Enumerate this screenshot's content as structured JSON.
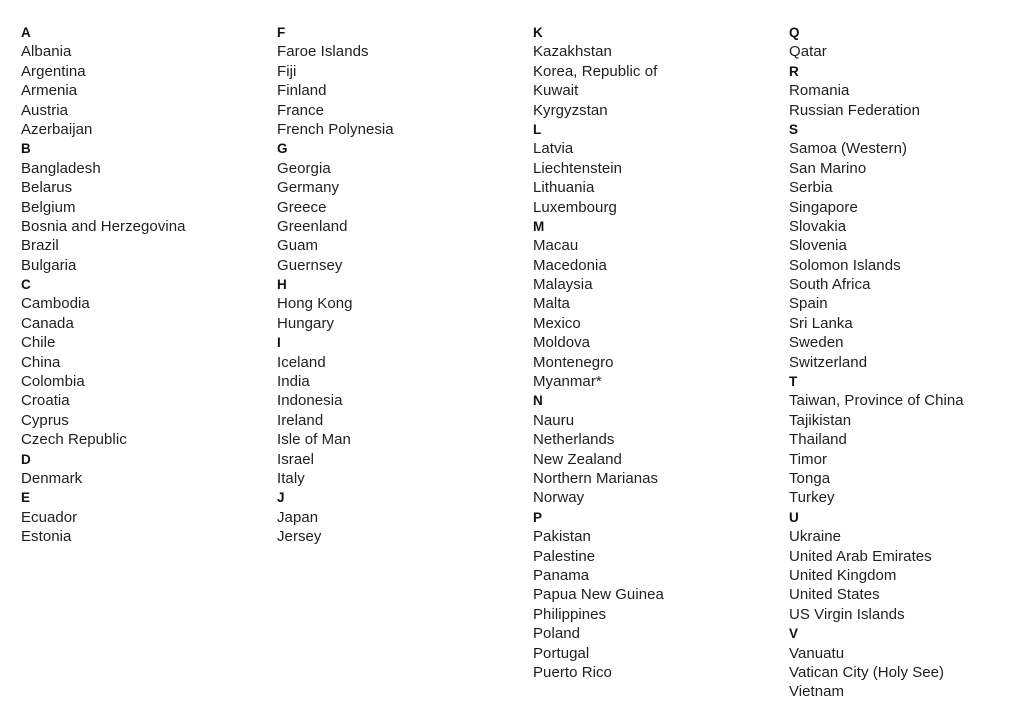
{
  "document": {
    "type": "country-index-list",
    "text_color": "#1f1f1f",
    "heading_color": "#111111",
    "background_color": "#ffffff",
    "columns": [
      {
        "groups": [
          {
            "letter": "A",
            "countries": [
              "Albania",
              "Argentina",
              "Armenia",
              "Austria",
              "Azerbaijan"
            ]
          },
          {
            "letter": "B",
            "countries": [
              "Bangladesh",
              "Belarus",
              "Belgium",
              "Bosnia and Herzegovina",
              "Brazil",
              "Bulgaria"
            ]
          },
          {
            "letter": "C",
            "countries": [
              "Cambodia",
              "Canada",
              "Chile",
              "China",
              "Colombia",
              "Croatia",
              "Cyprus",
              "Czech Republic"
            ]
          },
          {
            "letter": "D",
            "countries": [
              "Denmark"
            ]
          },
          {
            "letter": "E",
            "countries": [
              "Ecuador",
              "Estonia"
            ]
          }
        ]
      },
      {
        "groups": [
          {
            "letter": "F",
            "countries": [
              "Faroe Islands",
              "Fiji",
              "Finland",
              "France",
              "French Polynesia"
            ]
          },
          {
            "letter": "G",
            "countries": [
              "Georgia",
              "Germany",
              "Greece",
              "Greenland",
              "Guam",
              "Guernsey"
            ]
          },
          {
            "letter": "H",
            "countries": [
              "Hong Kong",
              "Hungary"
            ]
          },
          {
            "letter": "I",
            "countries": [
              "Iceland",
              "India",
              "Indonesia",
              "Ireland",
              "Isle of Man",
              "Israel",
              "Italy"
            ]
          },
          {
            "letter": "J",
            "countries": [
              "Japan",
              "Jersey"
            ]
          }
        ]
      },
      {
        "groups": [
          {
            "letter": "K",
            "countries": [
              "Kazakhstan",
              "Korea, Republic of",
              "Kuwait",
              "Kyrgyzstan"
            ]
          },
          {
            "letter": "L",
            "countries": [
              "Latvia",
              "Liechtenstein",
              "Lithuania",
              "Luxembourg"
            ]
          },
          {
            "letter": "M",
            "countries": [
              "Macau",
              "Macedonia",
              "Malaysia",
              "Malta",
              "Mexico",
              "Moldova",
              "Montenegro",
              "Myanmar*"
            ]
          },
          {
            "letter": "N",
            "countries": [
              "Nauru",
              "Netherlands",
              "New Zealand",
              "Northern Marianas",
              "Norway"
            ]
          },
          {
            "letter": "P",
            "countries": [
              "Pakistan",
              "Palestine",
              "Panama",
              "Papua New Guinea",
              "Philippines",
              "Poland",
              "Portugal",
              "Puerto Rico"
            ]
          }
        ]
      },
      {
        "groups": [
          {
            "letter": "Q",
            "countries": [
              "Qatar"
            ]
          },
          {
            "letter": "R",
            "countries": [
              "Romania",
              "Russian Federation"
            ]
          },
          {
            "letter": "S",
            "countries": [
              "Samoa (Western)",
              "San Marino",
              "Serbia",
              "Singapore",
              "Slovakia",
              "Slovenia",
              "Solomon Islands",
              "South Africa",
              "Spain",
              "Sri Lanka",
              "Sweden",
              "Switzerland"
            ]
          },
          {
            "letter": "T",
            "countries": [
              "Taiwan, Province of China",
              "Tajikistan",
              "Thailand",
              "Timor",
              "Tonga",
              "Turkey"
            ]
          },
          {
            "letter": "U",
            "countries": [
              "Ukraine",
              "United Arab Emirates",
              "United Kingdom",
              "United States",
              "US Virgin Islands"
            ]
          },
          {
            "letter": "V",
            "countries": [
              "Vanuatu",
              "Vatican City (Holy See)",
              "Vietnam"
            ]
          }
        ]
      }
    ]
  }
}
